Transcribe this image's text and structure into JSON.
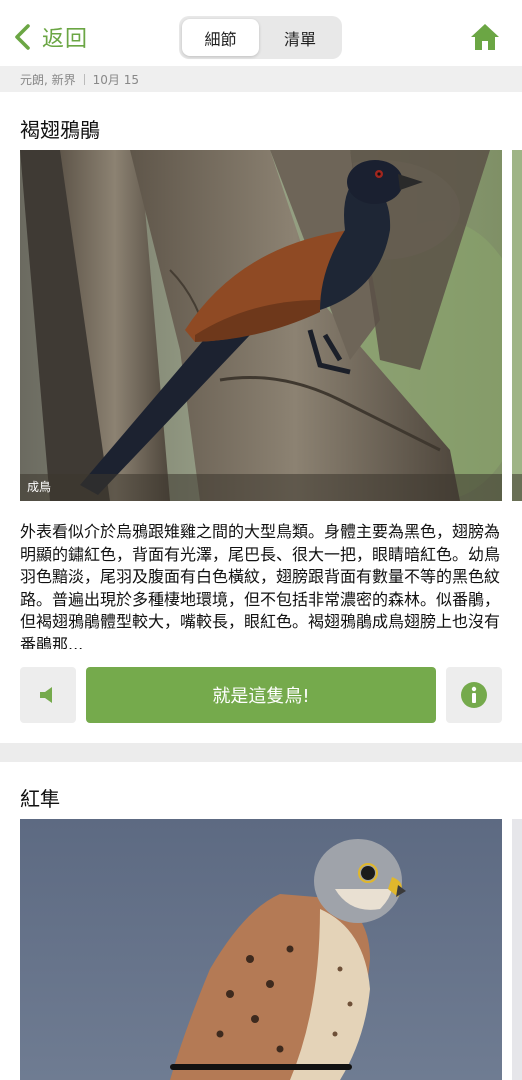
{
  "nav": {
    "back_label": "返回",
    "tabs": [
      {
        "label": "細節",
        "selected": true
      },
      {
        "label": "清單",
        "selected": false
      }
    ],
    "home_icon": "home-icon",
    "accent_color": "#6ba644"
  },
  "location": {
    "place": "元朗, 新界",
    "date": "10月 15"
  },
  "cards": [
    {
      "name": "褐翅鴉鵑",
      "photo_label": "成鳥",
      "description": "外表看似介於烏鴉跟雉雞之間的大型鳥類。身體主要為黑色，翅膀為明顯的鏽紅色，背面有光澤，尾巴長、很大一把，眼睛暗紅色。幼鳥羽色黯淡，尾羽及腹面有白色橫紋，翅膀跟背面有數量不等的黑色紋路。普遍出現於多種棲地環境，但不包括非常濃密的森林。似番鵑，但褐翅鴉鵑體型較大，嘴較長，眼紅色。褐翅鴉鵑成鳥翅膀上也沒有番鵑那...",
      "confirm_label": "就是這隻鳥!",
      "sound_icon": "speaker-icon",
      "info_icon": "info-icon"
    },
    {
      "name": "紅隼"
    }
  ]
}
